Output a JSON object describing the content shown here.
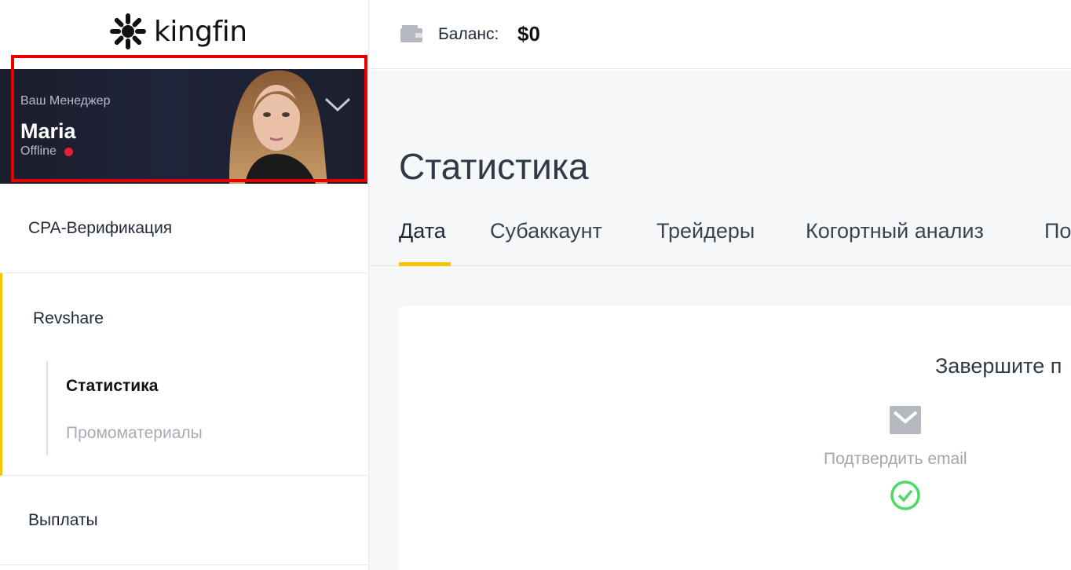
{
  "logo": {
    "text": "kingfin"
  },
  "header": {
    "balance_label": "Баланс:",
    "balance_value": "$0"
  },
  "manager": {
    "caption": "Ваш Менеджер",
    "name": "Maria",
    "status": "Offline",
    "status_color": "#e8203a"
  },
  "sidebar": {
    "cpa_label": "CPA-Верификация",
    "revshare_label": "Revshare",
    "sub_items": [
      "Статистика",
      "Промоматериалы"
    ],
    "payouts_label": "Выплаты"
  },
  "main": {
    "title": "Статистика",
    "tabs": [
      "Дата",
      "Субаккаунт",
      "Трейдеры",
      "Когортный анализ",
      "По"
    ],
    "card_title": "Завершите п",
    "confirm_label": "Подтвердить email"
  },
  "colors": {
    "accent": "#f5c400",
    "highlight": "#e60000",
    "success": "#4cd964"
  }
}
